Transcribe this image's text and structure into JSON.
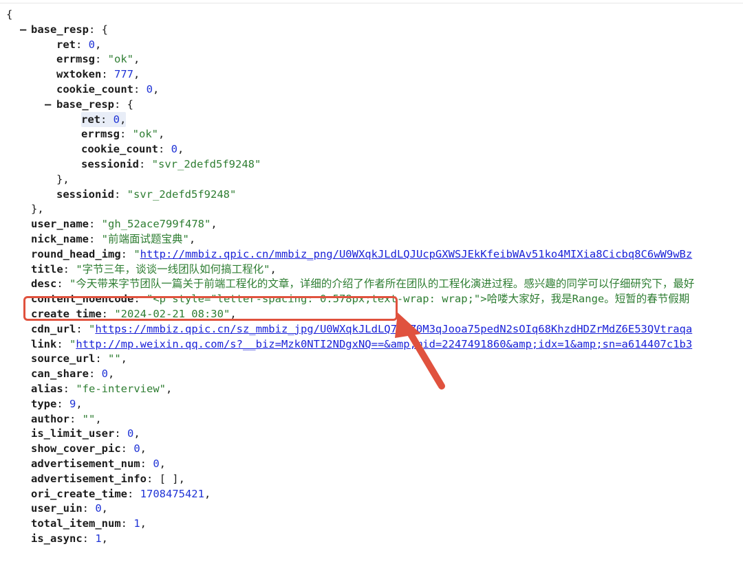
{
  "colors": {
    "key": "#1b1b1b",
    "number": "#1f33d6",
    "string": "#2e7d32",
    "link": "#1a22d8",
    "callout": "#e0523e"
  },
  "icons": {
    "toggle": "minus-collapse-icon",
    "callout": "red-arrow-annotation"
  },
  "lines": [
    {
      "indent": 0,
      "parts": [
        {
          "t": "p",
          "v": "{"
        }
      ]
    },
    {
      "indent": 1,
      "toggle": "–",
      "parts": [
        {
          "t": "k",
          "v": "base_resp"
        },
        {
          "t": "p",
          "v": ": {"
        }
      ]
    },
    {
      "indent": 2,
      "parts": [
        {
          "t": "k",
          "v": "ret"
        },
        {
          "t": "p",
          "v": ": "
        },
        {
          "t": "num",
          "v": "0"
        },
        {
          "t": "p",
          "v": ","
        }
      ]
    },
    {
      "indent": 2,
      "parts": [
        {
          "t": "k",
          "v": "errmsg"
        },
        {
          "t": "p",
          "v": ": "
        },
        {
          "t": "str",
          "v": "\"ok\""
        },
        {
          "t": "p",
          "v": ","
        }
      ]
    },
    {
      "indent": 2,
      "parts": [
        {
          "t": "k",
          "v": "wxtoken"
        },
        {
          "t": "p",
          "v": ": "
        },
        {
          "t": "num",
          "v": "777"
        },
        {
          "t": "p",
          "v": ","
        }
      ]
    },
    {
      "indent": 2,
      "parts": [
        {
          "t": "k",
          "v": "cookie_count"
        },
        {
          "t": "p",
          "v": ": "
        },
        {
          "t": "num",
          "v": "0"
        },
        {
          "t": "p",
          "v": ","
        }
      ]
    },
    {
      "indent": 2,
      "toggle": "–",
      "parts": [
        {
          "t": "k",
          "v": "base_resp"
        },
        {
          "t": "p",
          "v": ": {"
        }
      ]
    },
    {
      "indent": 3,
      "highlight": true,
      "parts": [
        {
          "t": "k",
          "v": "ret"
        },
        {
          "t": "p",
          "v": ": "
        },
        {
          "t": "num",
          "v": "0"
        },
        {
          "t": "p",
          "v": ","
        }
      ]
    },
    {
      "indent": 3,
      "parts": [
        {
          "t": "k",
          "v": "errmsg"
        },
        {
          "t": "p",
          "v": ": "
        },
        {
          "t": "str",
          "v": "\"ok\""
        },
        {
          "t": "p",
          "v": ","
        }
      ]
    },
    {
      "indent": 3,
      "parts": [
        {
          "t": "k",
          "v": "cookie_count"
        },
        {
          "t": "p",
          "v": ": "
        },
        {
          "t": "num",
          "v": "0"
        },
        {
          "t": "p",
          "v": ","
        }
      ]
    },
    {
      "indent": 3,
      "parts": [
        {
          "t": "k",
          "v": "sessionid"
        },
        {
          "t": "p",
          "v": ": "
        },
        {
          "t": "str",
          "v": "\"svr_2defd5f9248\""
        }
      ]
    },
    {
      "indent": 2,
      "parts": [
        {
          "t": "p",
          "v": "},"
        }
      ]
    },
    {
      "indent": 2,
      "parts": [
        {
          "t": "k",
          "v": "sessionid"
        },
        {
          "t": "p",
          "v": ": "
        },
        {
          "t": "str",
          "v": "\"svr_2defd5f9248\""
        }
      ]
    },
    {
      "indent": 1,
      "parts": [
        {
          "t": "p",
          "v": "},"
        }
      ]
    },
    {
      "indent": 1,
      "parts": [
        {
          "t": "k",
          "v": "user_name"
        },
        {
          "t": "p",
          "v": ": "
        },
        {
          "t": "str",
          "v": "\"gh_52ace799f478\""
        },
        {
          "t": "p",
          "v": ","
        }
      ]
    },
    {
      "indent": 1,
      "parts": [
        {
          "t": "k",
          "v": "nick_name"
        },
        {
          "t": "p",
          "v": ": "
        },
        {
          "t": "str",
          "v": "\"前端面试题宝典\""
        },
        {
          "t": "p",
          "v": ","
        }
      ]
    },
    {
      "indent": 1,
      "parts": [
        {
          "t": "k",
          "v": "round_head_img"
        },
        {
          "t": "p",
          "v": ": "
        },
        {
          "t": "str",
          "v": "\""
        },
        {
          "t": "url",
          "v": "http://mmbiz.qpic.cn/mmbiz_png/U0WXqkJLdLQJUcpGXWSJEkKfeibWAv51ko4MIXia8Cicbq8C6wW9wBz"
        }
      ]
    },
    {
      "indent": 1,
      "parts": [
        {
          "t": "k",
          "v": "title"
        },
        {
          "t": "p",
          "v": ": "
        },
        {
          "t": "str",
          "v": "\"字节三年，谈谈一线团队如何搞工程化\""
        },
        {
          "t": "p",
          "v": ","
        }
      ]
    },
    {
      "indent": 1,
      "parts": [
        {
          "t": "k",
          "v": "desc"
        },
        {
          "t": "p",
          "v": ": "
        },
        {
          "t": "str",
          "v": "\"今天带来字节团队一篇关于前端工程化的文章，详细的介绍了作者所在团队的工程化演进过程。感兴趣的同学可以仔细研究下，最好"
        }
      ]
    },
    {
      "indent": 1,
      "parts": [
        {
          "t": "k",
          "v": "content_noencode"
        },
        {
          "t": "p",
          "v": ": "
        },
        {
          "t": "str",
          "v": "\"<p style=\"letter-spacing: 0.578px;text-wrap: wrap;\">哈喽大家好，我是Range。短暂的春节假期"
        }
      ]
    },
    {
      "indent": 1,
      "parts": [
        {
          "t": "k",
          "v": "create_time"
        },
        {
          "t": "p",
          "v": ": "
        },
        {
          "t": "str",
          "v": "\"2024-02-21 08:30\""
        },
        {
          "t": "p",
          "v": ","
        }
      ]
    },
    {
      "indent": 1,
      "parts": [
        {
          "t": "k",
          "v": "cdn_url"
        },
        {
          "t": "p",
          "v": ": "
        },
        {
          "t": "str",
          "v": "\""
        },
        {
          "t": "url",
          "v": "https://mmbiz.qpic.cn/sz_mmbiz_jpg/U0WXqkJLdLQ7RCZ0M3qJooa75pedN2sOIq68KhzdHDZrMdZ6E53QVtraqa"
        }
      ]
    },
    {
      "indent": 1,
      "parts": [
        {
          "t": "k",
          "v": "link"
        },
        {
          "t": "p",
          "v": ": "
        },
        {
          "t": "str",
          "v": "\""
        },
        {
          "t": "url",
          "v": "http://mp.weixin.qq.com/s?__biz=Mzk0NTI2NDgxNQ==&amp;mid=2247491860&amp;idx=1&amp;sn=a614407c1b3"
        }
      ]
    },
    {
      "indent": 1,
      "parts": [
        {
          "t": "k",
          "v": "source_url"
        },
        {
          "t": "p",
          "v": ": "
        },
        {
          "t": "str",
          "v": "\"\""
        },
        {
          "t": "p",
          "v": ","
        }
      ]
    },
    {
      "indent": 1,
      "parts": [
        {
          "t": "k",
          "v": "can_share"
        },
        {
          "t": "p",
          "v": ": "
        },
        {
          "t": "num",
          "v": "0"
        },
        {
          "t": "p",
          "v": ","
        }
      ]
    },
    {
      "indent": 1,
      "parts": [
        {
          "t": "k",
          "v": "alias"
        },
        {
          "t": "p",
          "v": ": "
        },
        {
          "t": "str",
          "v": "\"fe-interview\""
        },
        {
          "t": "p",
          "v": ","
        }
      ]
    },
    {
      "indent": 1,
      "parts": [
        {
          "t": "k",
          "v": "type"
        },
        {
          "t": "p",
          "v": ": "
        },
        {
          "t": "num",
          "v": "9"
        },
        {
          "t": "p",
          "v": ","
        }
      ]
    },
    {
      "indent": 1,
      "parts": [
        {
          "t": "k",
          "v": "author"
        },
        {
          "t": "p",
          "v": ": "
        },
        {
          "t": "str",
          "v": "\"\""
        },
        {
          "t": "p",
          "v": ","
        }
      ]
    },
    {
      "indent": 1,
      "parts": [
        {
          "t": "k",
          "v": "is_limit_user"
        },
        {
          "t": "p",
          "v": ": "
        },
        {
          "t": "num",
          "v": "0"
        },
        {
          "t": "p",
          "v": ","
        }
      ]
    },
    {
      "indent": 1,
      "parts": [
        {
          "t": "k",
          "v": "show_cover_pic"
        },
        {
          "t": "p",
          "v": ": "
        },
        {
          "t": "num",
          "v": "0"
        },
        {
          "t": "p",
          "v": ","
        }
      ]
    },
    {
      "indent": 1,
      "parts": [
        {
          "t": "k",
          "v": "advertisement_num"
        },
        {
          "t": "p",
          "v": ": "
        },
        {
          "t": "num",
          "v": "0"
        },
        {
          "t": "p",
          "v": ","
        }
      ]
    },
    {
      "indent": 1,
      "parts": [
        {
          "t": "k",
          "v": "advertisement_info"
        },
        {
          "t": "p",
          "v": ": [ ],"
        }
      ]
    },
    {
      "indent": 1,
      "parts": [
        {
          "t": "k",
          "v": "ori_create_time"
        },
        {
          "t": "p",
          "v": ": "
        },
        {
          "t": "num",
          "v": "1708475421"
        },
        {
          "t": "p",
          "v": ","
        }
      ]
    },
    {
      "indent": 1,
      "parts": [
        {
          "t": "k",
          "v": "user_uin"
        },
        {
          "t": "p",
          "v": ": "
        },
        {
          "t": "num",
          "v": "0"
        },
        {
          "t": "p",
          "v": ","
        }
      ]
    },
    {
      "indent": 1,
      "parts": [
        {
          "t": "k",
          "v": "total_item_num"
        },
        {
          "t": "p",
          "v": ": "
        },
        {
          "t": "num",
          "v": "1"
        },
        {
          "t": "p",
          "v": ","
        }
      ]
    },
    {
      "indent": 1,
      "parts": [
        {
          "t": "k",
          "v": "is_async"
        },
        {
          "t": "p",
          "v": ": "
        },
        {
          "t": "num",
          "v": "1"
        },
        {
          "t": "p",
          "v": ","
        }
      ]
    }
  ]
}
